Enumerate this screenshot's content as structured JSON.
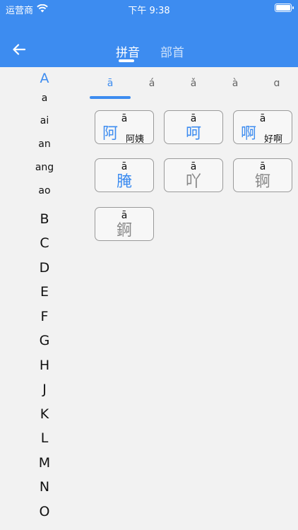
{
  "status": {
    "carrier": "运营商",
    "time": "下午 9:38"
  },
  "nav": {
    "tabs": [
      {
        "label": "拼音",
        "active": true
      },
      {
        "label": "部首",
        "active": false
      }
    ]
  },
  "sidebar": {
    "active_letter": "A",
    "a_group": {
      "letter": "A",
      "items": [
        "a",
        "ai",
        "an",
        "ang",
        "ao"
      ]
    },
    "letters": [
      "B",
      "C",
      "D",
      "E",
      "F",
      "G",
      "H",
      "J",
      "K",
      "L",
      "M",
      "N",
      "O"
    ]
  },
  "tones": [
    "ā",
    "á",
    "ǎ",
    "à",
    "ɑ"
  ],
  "active_tone": "ā",
  "cards": [
    {
      "pinyin": "ā",
      "char": "阿",
      "word": "阿姨",
      "color": "blue"
    },
    {
      "pinyin": "ā",
      "char": "呵",
      "word": "",
      "color": "blue"
    },
    {
      "pinyin": "ā",
      "char": "啊",
      "word": "好啊",
      "color": "blue"
    },
    {
      "pinyin": "ā",
      "char": "腌",
      "word": "",
      "color": "blue"
    },
    {
      "pinyin": "ā",
      "char": "吖",
      "word": "",
      "color": "gray"
    },
    {
      "pinyin": "ā",
      "char": "锕",
      "word": "",
      "color": "gray"
    },
    {
      "pinyin": "ā",
      "char": "錒",
      "word": "",
      "color": "gray"
    }
  ],
  "colors": {
    "primary": "#3d8cf0",
    "background": "#f2f2f2"
  },
  "icons": {
    "back": "arrow-left-icon",
    "wifi": "wifi-icon",
    "battery": "battery-icon"
  }
}
